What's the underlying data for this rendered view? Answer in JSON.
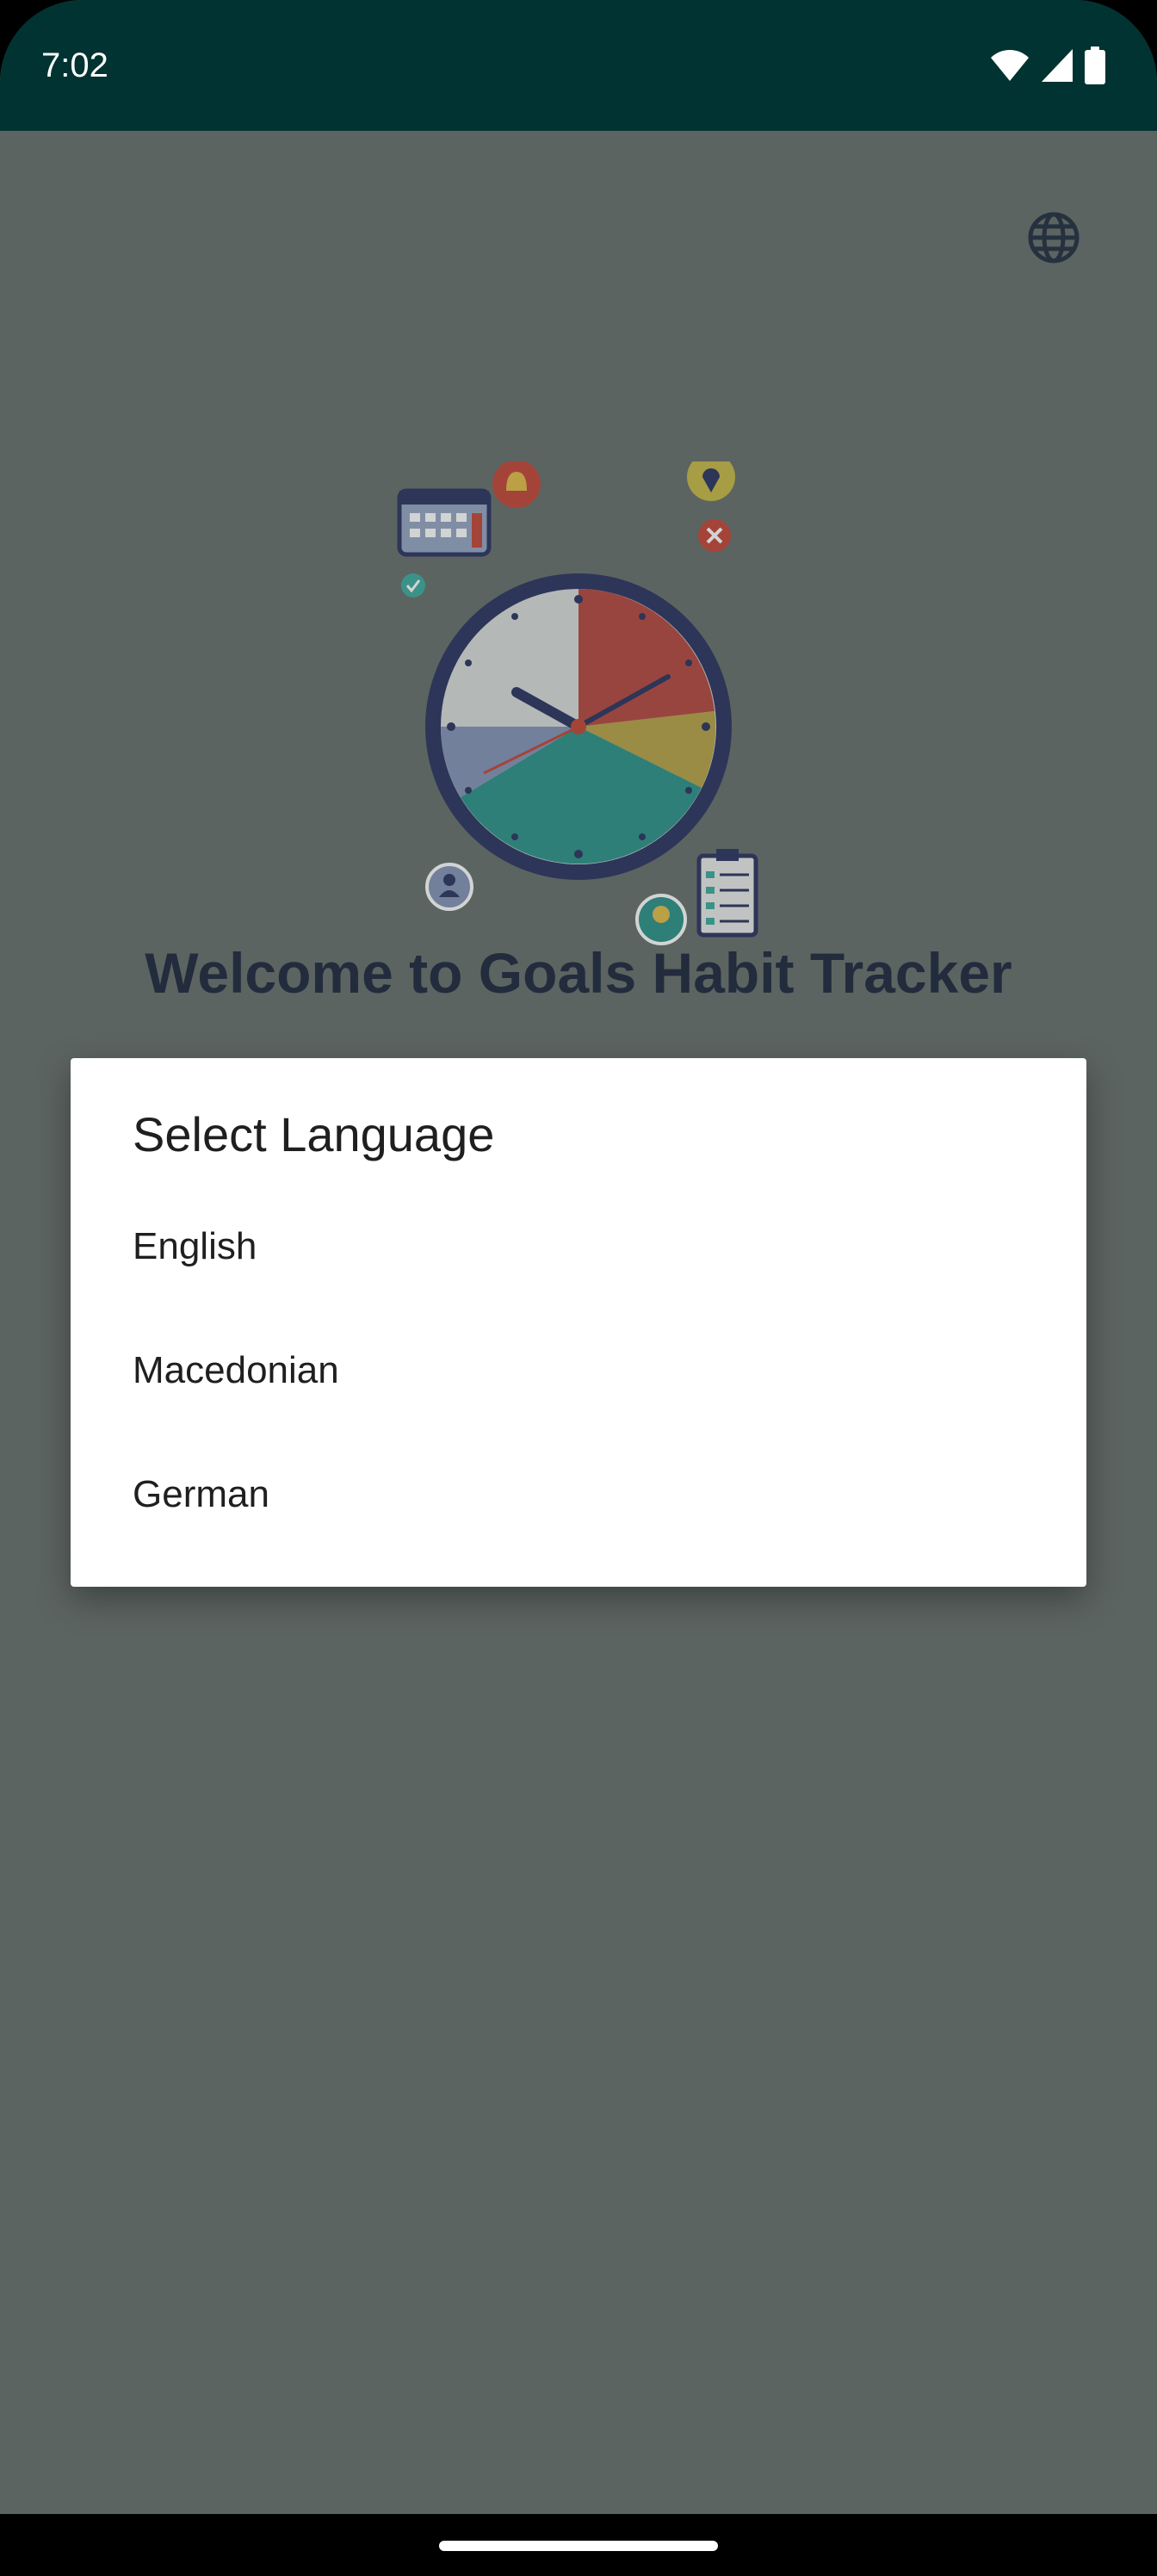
{
  "status_bar": {
    "time": "7:02",
    "icons": [
      "wifi-icon",
      "cellular-signal-icon",
      "battery-icon"
    ]
  },
  "header": {
    "language_button_icon": "globe-icon"
  },
  "welcome": {
    "title": "Welcome to Goals Habit Tracker"
  },
  "language_dialog": {
    "title": "Select Language",
    "options": [
      {
        "label": "English"
      },
      {
        "label": "Macedonian"
      },
      {
        "label": "German"
      }
    ]
  },
  "colors": {
    "status_bar_bg": "#003331",
    "scrim_bg": "#5c6461",
    "title_text": "#232c3d",
    "dialog_bg": "#ffffff"
  }
}
